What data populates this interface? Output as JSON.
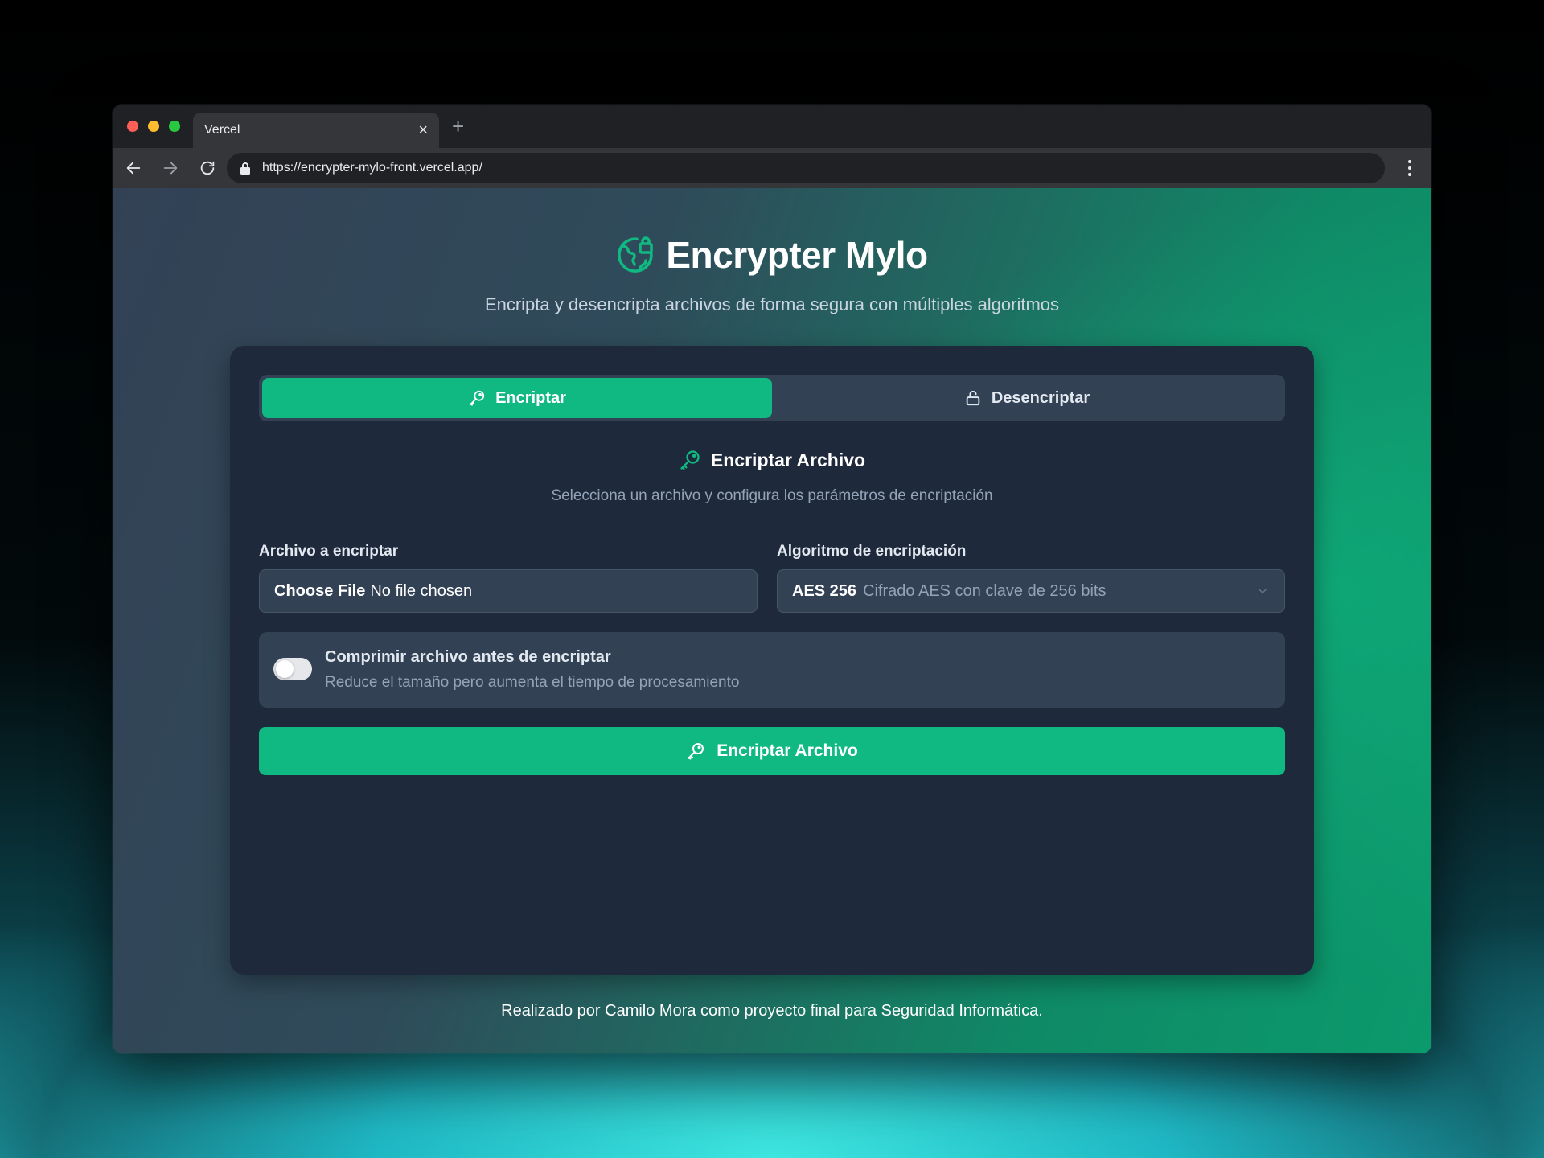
{
  "browser": {
    "tab_title": "Vercel",
    "url": "https://encrypter-mylo-front.vercel.app/"
  },
  "app": {
    "title": "Encrypter Mylo",
    "subtitle": "Encripta y desencripta archivos de forma segura con múltiples algoritmos",
    "accent_color": "#10b981"
  },
  "tabs": [
    {
      "label": "Encriptar",
      "icon": "key-icon",
      "active": true
    },
    {
      "label": "Desencriptar",
      "icon": "unlock-icon",
      "active": false
    }
  ],
  "section": {
    "title": "Encriptar Archivo",
    "description": "Selecciona un archivo y configura los parámetros de encriptación"
  },
  "file_field": {
    "label": "Archivo a encriptar",
    "button_label": "Choose File",
    "value": "No file chosen"
  },
  "algorithm_field": {
    "label": "Algoritmo de encriptación",
    "selected": "AES 256",
    "selected_desc": "Cifrado AES con clave de 256 bits"
  },
  "compress": {
    "title": "Comprimir archivo antes de encriptar",
    "description": "Reduce el tamaño pero aumenta el tiempo de procesamiento",
    "enabled": false
  },
  "submit_label": "Encriptar Archivo",
  "footer": "Realizado por Camilo Mora como proyecto final para Seguridad Informática."
}
